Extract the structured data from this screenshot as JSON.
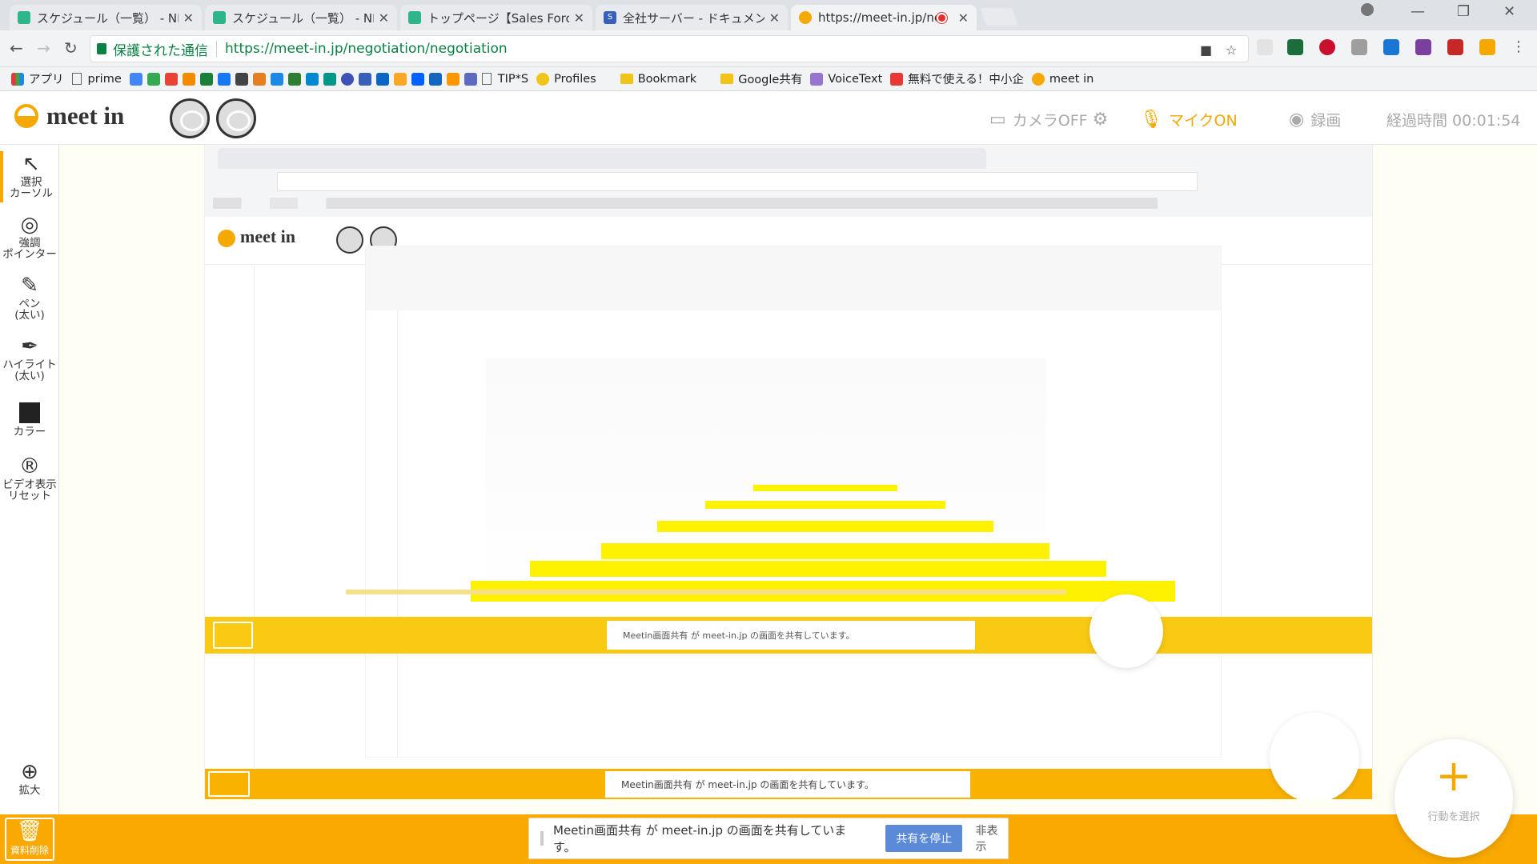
{
  "browser": {
    "tabs": [
      {
        "title": "スケジュール（一覧） - NI",
        "icon": "calendar-favicon"
      },
      {
        "title": "スケジュール（一覧） - NI",
        "icon": "calendar-favicon"
      },
      {
        "title": "トップページ【Sales Force A",
        "icon": "calendar-favicon"
      },
      {
        "title": "全社サーバー - ドキュメント -",
        "icon": "s-favicon"
      },
      {
        "title": "https://meet-in.jp/ne",
        "icon": "meetin-favicon",
        "active": true
      }
    ],
    "secure_label": "保護された通信",
    "url": "https://meet-in.jp/negotiation/negotiation",
    "bookmarks": [
      {
        "label": "アプリ",
        "icon": "apps-grid-icon"
      },
      {
        "label": "prime",
        "icon": "page-icon"
      },
      {
        "label": "TIP*S",
        "icon": "page-icon"
      },
      {
        "label": "Profiles",
        "icon": "profiles-icon"
      },
      {
        "label": "Bookmark",
        "icon": "folder-icon"
      },
      {
        "label": "Google共有",
        "icon": "folder-icon"
      },
      {
        "label": "VoiceText",
        "icon": "voicetext-icon"
      },
      {
        "label": "無料で使える！中小企",
        "icon": "red-square-icon"
      },
      {
        "label": "meet in",
        "icon": "meetin-icon"
      }
    ]
  },
  "app": {
    "brand": "meet in",
    "camera_label": "カメラOFF",
    "mic_label": "マイクON",
    "record_label": "録画",
    "elapsed_label": "経過時間 00:01:54",
    "accent": "#f5a800"
  },
  "toolbar": {
    "select_cursor": "選択\nカーソル",
    "pointer": "強調\nポインター",
    "pen": "ペン\n(太い)",
    "highlight": "ハイライト\n(太い)",
    "color": "カラー",
    "video_reset": "ビデオ表示\nリセット",
    "zoom": "拡大"
  },
  "bottom": {
    "delete_material": "資料削除",
    "share_notice": "Meetin画面共有 が meet-in.jp の画面を共有しています。",
    "stop_share": "共有を停止",
    "hide": "非表示",
    "action_select": "行動を選択"
  }
}
